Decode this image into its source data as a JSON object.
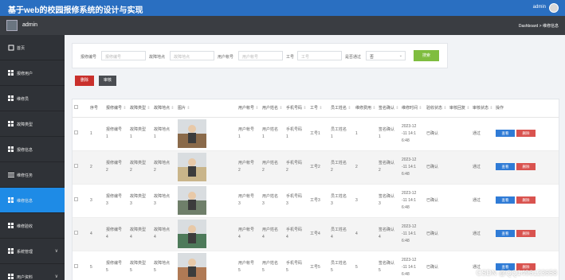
{
  "app": {
    "title": "基于web的校园报修系统的设计与实现",
    "user": "admin"
  },
  "sidebar": {
    "name": "admin",
    "items": [
      {
        "label": "首页",
        "icon": "home-icon",
        "active": false
      },
      {
        "label": "报修用户",
        "icon": "grid-icon",
        "active": false
      },
      {
        "label": "维修员",
        "icon": "grid-icon",
        "active": false
      },
      {
        "label": "故障类型",
        "icon": "grid-icon",
        "active": false
      },
      {
        "label": "报修信息",
        "icon": "grid-icon",
        "active": false
      },
      {
        "label": "维修任务",
        "icon": "list-icon",
        "active": false
      },
      {
        "label": "维修信息",
        "icon": "grid-icon",
        "active": true
      },
      {
        "label": "维修验收",
        "icon": "grid-icon",
        "active": false
      },
      {
        "label": "系统管理",
        "icon": "grid-icon",
        "active": false,
        "chevron": "∨"
      },
      {
        "label": "用户资料",
        "icon": "grid-icon",
        "active": false,
        "chevron": "∨"
      }
    ]
  },
  "breadcrumb": "Dashboard > 维修信息",
  "search": {
    "repair_no_label": "报修编号",
    "repair_no_placeholder": "报修编号",
    "fault_loc_label": "故障地点",
    "fault_loc_placeholder": "故障地点",
    "account_label": "用户帐号",
    "account_placeholder": "用户帐号",
    "worker_no_label": "工号",
    "worker_no_placeholder": "工号",
    "passed_label": "是否通过",
    "passed_value": "否",
    "search_button": "搜索"
  },
  "toolbar": {
    "delete_label": "删除",
    "audit_label": "审核"
  },
  "table": {
    "columns": [
      "序号",
      "报修编号",
      "故障类型",
      "故障地点",
      "图片",
      "用户帐号",
      "用户姓名",
      "手机号码",
      "工号",
      "员工姓名",
      "维修费用",
      "签名确认",
      "维修时间",
      "验收状态",
      "审核回复",
      "审核状态",
      "操作"
    ],
    "sort_glyph": "⇕",
    "rows": [
      {
        "n": "1",
        "repair_no": "报修编号\n1",
        "fault_type": "故障类型\n1",
        "fault_loc": "故障地点\n1",
        "account": "用户帐号\n1",
        "user_name": "用户姓名\n1",
        "phone": "手机号码\n1",
        "worker_no": "工号1",
        "staff": "员工姓名\n1",
        "fee": "1",
        "sign": "签名确认\n1",
        "time": "2023-12\n-11 14:1\n6:48",
        "accept": "已确认",
        "reply": "",
        "status": "通过",
        "photo_color": "#8a6a4a"
      },
      {
        "n": "2",
        "repair_no": "报修编号\n2",
        "fault_type": "故障类型\n2",
        "fault_loc": "故障地点\n2",
        "account": "用户帐号\n2",
        "user_name": "用户姓名\n2",
        "phone": "手机号码\n2",
        "worker_no": "工号2",
        "staff": "员工姓名\n2",
        "fee": "2",
        "sign": "签名确认\n2",
        "time": "2023-12\n-11 14:1\n6:48",
        "accept": "已确认",
        "reply": "",
        "status": "通过",
        "photo_color": "#c9b58a"
      },
      {
        "n": "3",
        "repair_no": "报修编号\n3",
        "fault_type": "故障类型\n3",
        "fault_loc": "故障地点\n3",
        "account": "用户帐号\n3",
        "user_name": "用户姓名\n3",
        "phone": "手机号码\n3",
        "worker_no": "工号3",
        "staff": "员工姓名\n3",
        "fee": "3",
        "sign": "签名确认\n3",
        "time": "2023-12\n-11 14:1\n6:48",
        "accept": "已确认",
        "reply": "",
        "status": "通过",
        "photo_color": "#6f7f6a"
      },
      {
        "n": "4",
        "repair_no": "报修编号\n4",
        "fault_type": "故障类型\n4",
        "fault_loc": "故障地点\n4",
        "account": "用户帐号\n4",
        "user_name": "用户姓名\n4",
        "phone": "手机号码\n4",
        "worker_no": "工号4",
        "staff": "员工姓名\n4",
        "fee": "4",
        "sign": "签名确认\n4",
        "time": "2023-12\n-11 14:1\n6:48",
        "accept": "已确认",
        "reply": "",
        "status": "通过",
        "photo_color": "#4d7a5a"
      },
      {
        "n": "5",
        "repair_no": "报修编号\n5",
        "fault_type": "故障类型\n5",
        "fault_loc": "故障地点\n5",
        "account": "用户帐号\n5",
        "user_name": "用户姓名\n5",
        "phone": "手机号码\n5",
        "worker_no": "工号5",
        "staff": "员工姓名\n5",
        "fee": "5",
        "sign": "签名确认\n5",
        "time": "2023-12\n-11 14:1\n6:48",
        "accept": "已确认",
        "reply": "",
        "status": "通过",
        "photo_color": "#b07a55"
      }
    ],
    "view_label": "查看",
    "delete_label": "删除"
  },
  "watermark": "CSDN @QQ1496123658",
  "colors": {
    "topbar": "#2a6fc1",
    "sidebar": "#2f3237",
    "active": "#1e8be6",
    "search": "#7fbd3f",
    "danger": "#c9302c",
    "view": "#2f7bd6"
  }
}
